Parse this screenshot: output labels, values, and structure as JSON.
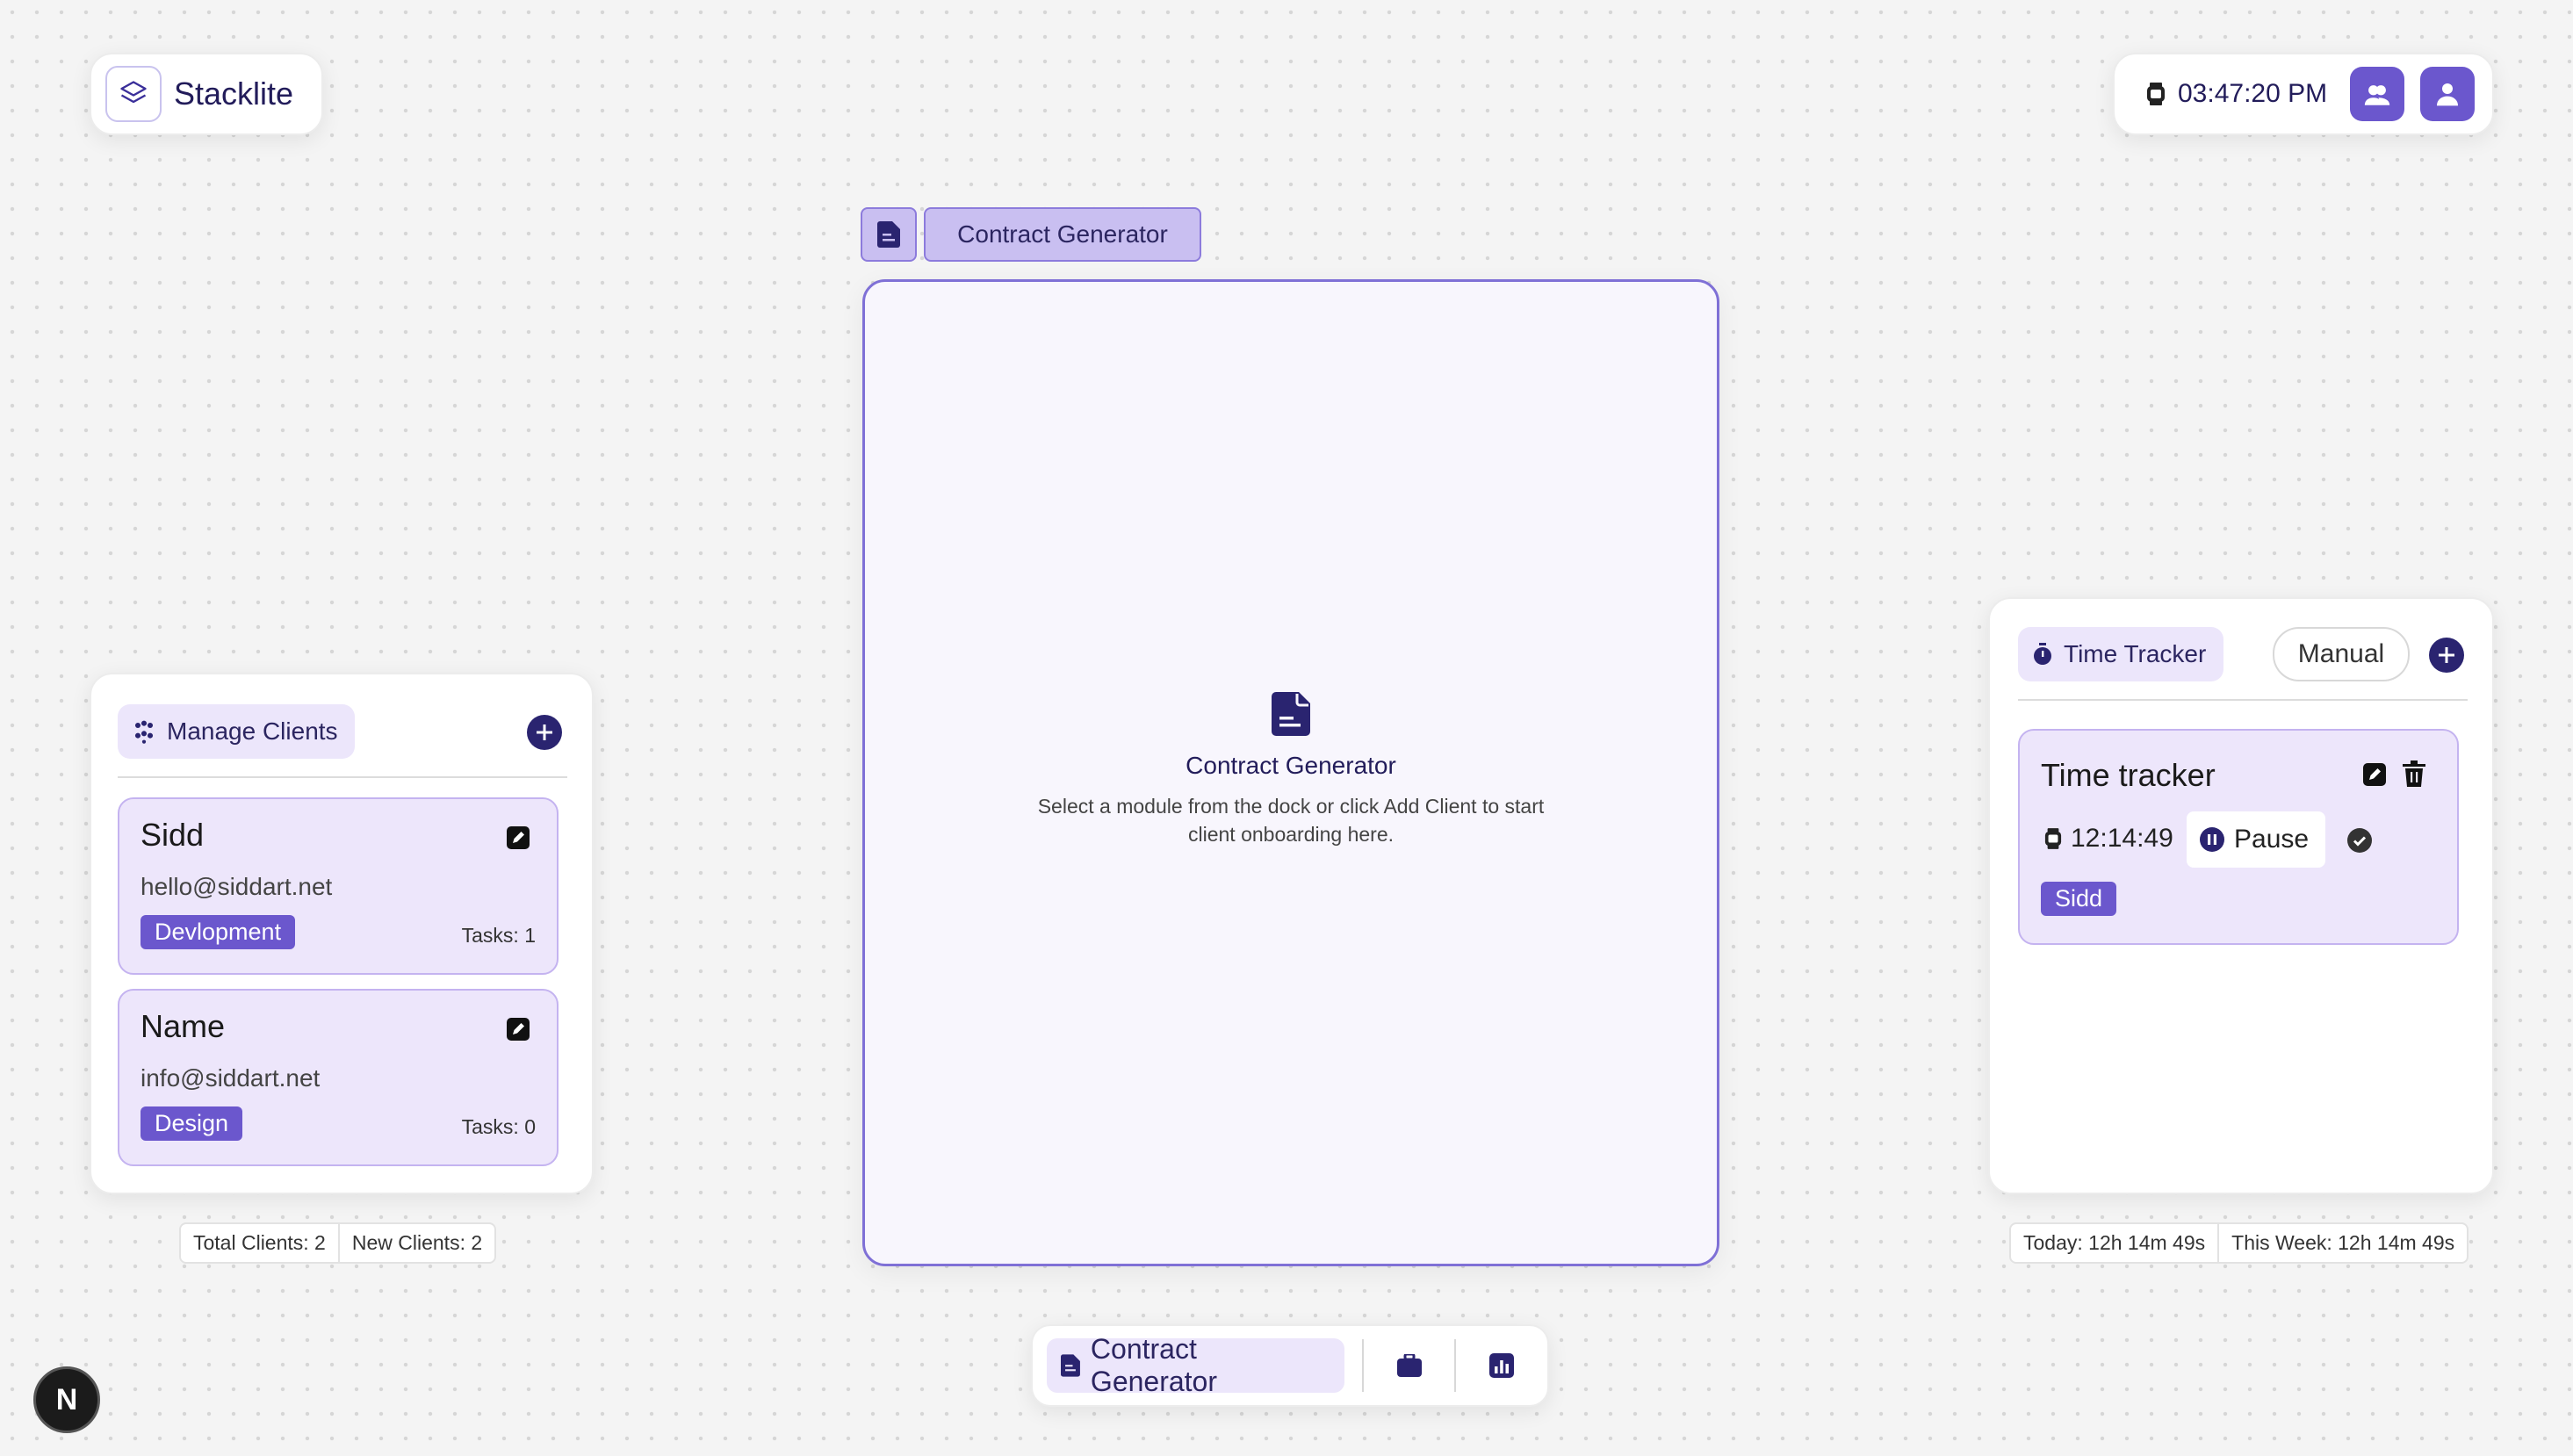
{
  "brand": {
    "name": "Stacklite",
    "icon": "layers-icon"
  },
  "header": {
    "clock": "03:47:20 PM",
    "buttons": [
      "team-icon",
      "user-icon"
    ]
  },
  "workspace": {
    "tab_label": "Contract Generator",
    "empty_state": {
      "title": "Contract Generator",
      "description": "Select a module from the dock or click Add Client to start client onboarding here."
    }
  },
  "clients_panel": {
    "title": "Manage Clients",
    "clients": [
      {
        "name": "Sidd",
        "email": "hello@siddart.net",
        "tag": "Devlopment",
        "tasks": "Tasks: 1"
      },
      {
        "name": "Name",
        "email": "info@siddart.net",
        "tag": "Design",
        "tasks": "Tasks: 0"
      }
    ],
    "stats": {
      "total": "Total Clients: 2",
      "new": "New Clients: 2"
    }
  },
  "tracker_panel": {
    "title": "Time Tracker",
    "mode": "Manual",
    "entry": {
      "title": "Time tracker",
      "elapsed": "12:14:49",
      "pause_label": "Pause",
      "client_tag": "Sidd"
    },
    "stats": {
      "today": "Today: 12h 14m 49s",
      "week": "This Week: 12h 14m 49s"
    }
  },
  "dock": {
    "active_label": "Contract Generator"
  },
  "badge": {
    "letter": "N"
  },
  "colors": {
    "accent": "#6b57cd",
    "dark_accent": "#2a2470",
    "tab_bg": "#c9bff1",
    "card_bg": "#ede6fb"
  }
}
